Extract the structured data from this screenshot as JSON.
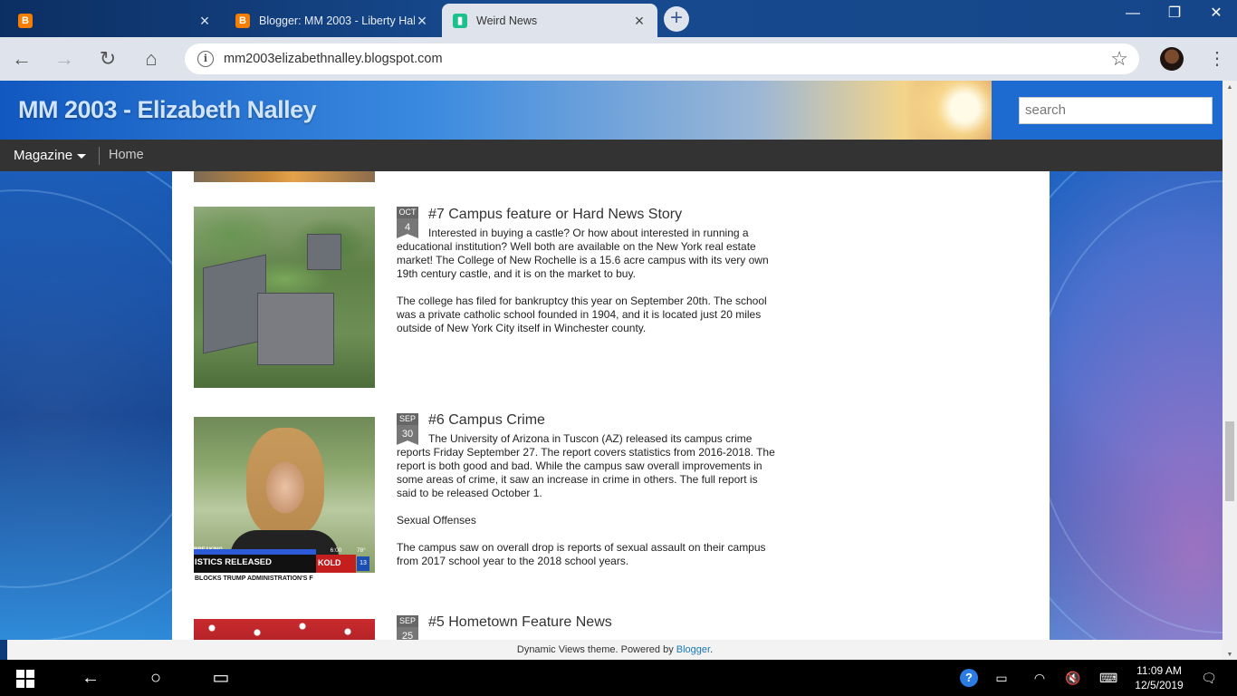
{
  "browser": {
    "tabs": [
      {
        "title": "",
        "favicon": "blogger-icon",
        "active": false
      },
      {
        "title": "Blogger: MM 2003 - Liberty Hall",
        "favicon": "blogger-icon",
        "active": false
      },
      {
        "title": "Weird News",
        "favicon": "weird-news-icon",
        "active": true
      }
    ],
    "url": "mm2003elizabethnalley.blogspot.com"
  },
  "site": {
    "title": "MM 2003 - Elizabeth Nalley",
    "search_placeholder": "search",
    "menu": {
      "magazine_label": "Magazine",
      "home_label": "Home"
    }
  },
  "posts": [
    {
      "month": "OCT",
      "day": "4",
      "title": "#7 Campus feature or Hard News Story",
      "paragraphs": [
        "Interested in buying a castle? Or how about interested in running a educational institution? Well both are available on the New York real estate market! The College of New Rochelle is a 15.6 acre campus with its very own 19th century castle, and it is on the market to buy.",
        "The college has filed for bankruptcy this year on September 20th. The school was a private catholic school founded in 1904, and it is located just 20 miles outside of New York City itself in Winchester county."
      ]
    },
    {
      "month": "SEP",
      "day": "30",
      "title": "#6 Campus Crime",
      "paragraphs": [
        "The University of Arizona in Tuscon (AZ) released its campus crime reports Friday September 27. The report covers statistics from 2016-2018. The report is both good and bad. While the campus saw overall improvements in some areas of crime, it saw an increase in crime in others. The full report is said to be released October 1.",
        "Sexual Offenses",
        "The campus saw on overall drop is reports of sexual assault on their campus from 2017 school year to the 2018 school years."
      ],
      "thumb_ticker": {
        "breaking": "BREAKING",
        "headline": "ISTICS RELEASED",
        "subline": "ONA",
        "crawl": "BLOCKS TRUMP ADMINISTRATION'S F",
        "station": "KOLD",
        "channel": "13",
        "city": "TUCSON",
        "time": "6:00",
        "temp": "78°"
      }
    },
    {
      "month": "SEP",
      "day": "25",
      "title": "#5 Hometown Feature News",
      "paragraphs": []
    }
  ],
  "footer": {
    "text": "Dynamic Views theme. Powered by ",
    "link": "Blogger",
    "suffix": "."
  },
  "taskbar": {
    "time": "11:09 AM",
    "date": "12/5/2019"
  }
}
